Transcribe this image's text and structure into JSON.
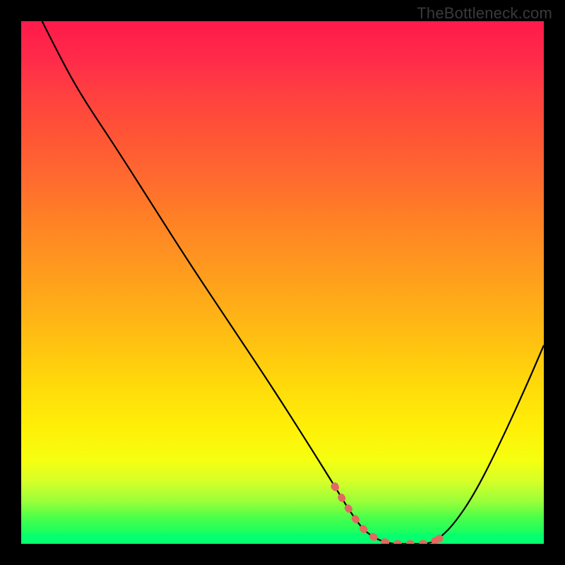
{
  "watermark": "TheBottleneck.com",
  "chart_data": {
    "type": "line",
    "title": "",
    "xlabel": "",
    "ylabel": "",
    "background_gradient": {
      "orientation": "vertical",
      "stops": [
        {
          "pos": 0.0,
          "color": "#ff1a4a"
        },
        {
          "pos": 0.3,
          "color": "#ff6a2f"
        },
        {
          "pos": 0.6,
          "color": "#ffc310"
        },
        {
          "pos": 0.8,
          "color": "#f5ff10"
        },
        {
          "pos": 0.95,
          "color": "#4aff4a"
        },
        {
          "pos": 1.0,
          "color": "#10ff70"
        }
      ]
    },
    "xlim": [
      0,
      100
    ],
    "ylim": [
      0,
      100
    ],
    "series": [
      {
        "name": "bottleneck-curve",
        "color": "#000000",
        "x": [
          4,
          8,
          12,
          18,
          25,
          32,
          40,
          48,
          55,
          60,
          63,
          66,
          70,
          74,
          78,
          80,
          83,
          87,
          92,
          97,
          100
        ],
        "y": [
          100,
          92,
          85,
          76,
          65,
          54,
          42,
          30,
          19,
          11,
          6,
          2,
          0,
          0,
          0,
          1,
          4,
          10,
          20,
          31,
          38
        ]
      }
    ],
    "highlight": {
      "name": "optimal-range",
      "color": "#e2695f",
      "x": [
        60,
        63,
        66,
        70,
        74,
        78,
        80
      ],
      "y": [
        11,
        6,
        2,
        0,
        0,
        0,
        1
      ]
    }
  }
}
